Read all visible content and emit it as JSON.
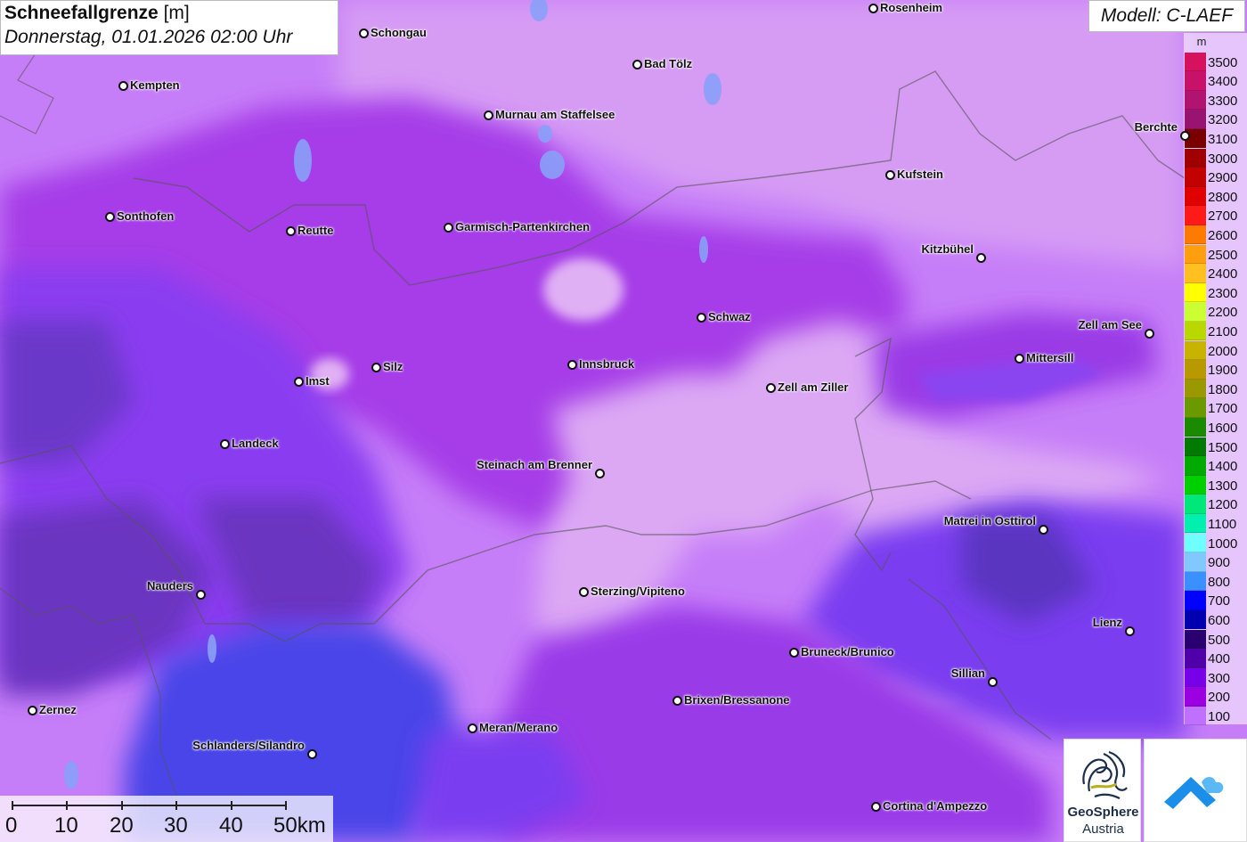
{
  "title": {
    "main_bold": "Schneefallgrenze",
    "main_unit": "[m]",
    "datetime": "Donnerstag, 01.01.2026 02:00 Uhr"
  },
  "model": {
    "label": "Modell: C-LAEF"
  },
  "legend": {
    "unit": "m",
    "entries": [
      {
        "value": "3500",
        "color": "#d6125f"
      },
      {
        "value": "3400",
        "color": "#c8126a"
      },
      {
        "value": "3300",
        "color": "#b01470"
      },
      {
        "value": "3200",
        "color": "#991470"
      },
      {
        "value": "3100",
        "color": "#7a0000"
      },
      {
        "value": "3000",
        "color": "#a00000"
      },
      {
        "value": "2900",
        "color": "#c20000"
      },
      {
        "value": "2800",
        "color": "#e00000"
      },
      {
        "value": "2700",
        "color": "#ff1a1a"
      },
      {
        "value": "2600",
        "color": "#ff7a00"
      },
      {
        "value": "2500",
        "color": "#ff9f10"
      },
      {
        "value": "2400",
        "color": "#ffc020"
      },
      {
        "value": "2300",
        "color": "#ffff00"
      },
      {
        "value": "2200",
        "color": "#ccff33"
      },
      {
        "value": "2100",
        "color": "#b8d800"
      },
      {
        "value": "2000",
        "color": "#c8b400"
      },
      {
        "value": "1900",
        "color": "#b89a00"
      },
      {
        "value": "1800",
        "color": "#9a9a00"
      },
      {
        "value": "1700",
        "color": "#6a9a00"
      },
      {
        "value": "1600",
        "color": "#1a8a00"
      },
      {
        "value": "1500",
        "color": "#007a00"
      },
      {
        "value": "1400",
        "color": "#00aa00"
      },
      {
        "value": "1300",
        "color": "#00d000"
      },
      {
        "value": "1200",
        "color": "#00e87a"
      },
      {
        "value": "1100",
        "color": "#00f0b0"
      },
      {
        "value": "1000",
        "color": "#70ffff"
      },
      {
        "value": "900",
        "color": "#80c8ff"
      },
      {
        "value": "800",
        "color": "#3a90ff"
      },
      {
        "value": "700",
        "color": "#0000ff"
      },
      {
        "value": "600",
        "color": "#0000b0"
      },
      {
        "value": "500",
        "color": "#2a0070"
      },
      {
        "value": "400",
        "color": "#5000a8"
      },
      {
        "value": "300",
        "color": "#7800e8"
      },
      {
        "value": "200",
        "color": "#9a00e0"
      },
      {
        "value": "100",
        "color": "#c070ff"
      }
    ]
  },
  "cities": [
    {
      "name": "Rosenheim"
    },
    {
      "name": "Schongau"
    },
    {
      "name": "Bad Tölz"
    },
    {
      "name": "Kempten"
    },
    {
      "name": "Murnau am Staffelsee"
    },
    {
      "name": "Berchte"
    },
    {
      "name": "Kufstein"
    },
    {
      "name": "Sonthofen"
    },
    {
      "name": "Reutte"
    },
    {
      "name": "Garmisch-Partenkirchen"
    },
    {
      "name": "Kitzbühel"
    },
    {
      "name": "Schwaz"
    },
    {
      "name": "Zell am See"
    },
    {
      "name": "Mittersill"
    },
    {
      "name": "Silz"
    },
    {
      "name": "Innsbruck"
    },
    {
      "name": "Imst"
    },
    {
      "name": "Zell am Ziller"
    },
    {
      "name": "Landeck"
    },
    {
      "name": "Steinach am Brenner"
    },
    {
      "name": "Matrei in Osttirol"
    },
    {
      "name": "Nauders"
    },
    {
      "name": "Sterzing/Vipiteno"
    },
    {
      "name": "Lienz"
    },
    {
      "name": "Bruneck/Brunico"
    },
    {
      "name": "Sillian"
    },
    {
      "name": "Brixen/Bressanone"
    },
    {
      "name": "Zernez"
    },
    {
      "name": "Meran/Merano"
    },
    {
      "name": "Schlanders/Silandro"
    },
    {
      "name": "Cortina d'Ampezzo"
    }
  ],
  "scale": {
    "labels": [
      "0",
      "10",
      "20",
      "30",
      "40",
      "50km"
    ]
  },
  "logo": {
    "line1": "GeoSphere",
    "line2": "Austria"
  }
}
